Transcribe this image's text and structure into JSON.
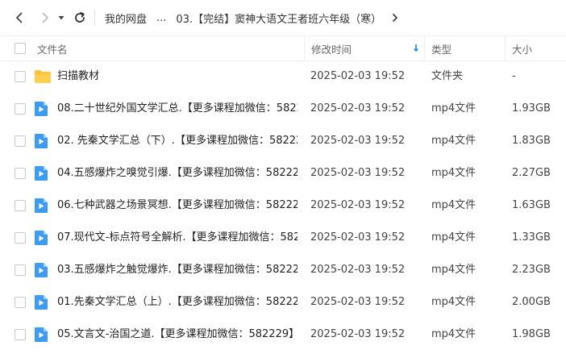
{
  "breadcrumb": {
    "root": "我的网盘",
    "ellipsis": "...",
    "current": "03.【完结】窦神大语文王者班六年级（寒）"
  },
  "columns": {
    "name": "文件名",
    "modified": "修改时间",
    "type": "类型",
    "size": "大小"
  },
  "files": [
    {
      "name": "扫描教材",
      "modified": "2025-02-03 19:52",
      "type": "文件夹",
      "size": "-",
      "icon": "folder-icon"
    },
    {
      "name": "08.二十世纪外国文学汇总.【更多课程加微信：58222...",
      "modified": "2025-02-03 19:52",
      "type": "mp4文件",
      "size": "1.93GB",
      "icon": "video-file-icon"
    },
    {
      "name": "02. 先秦文学汇总（下）.【更多课程加微信：582229...",
      "modified": "2025-02-03 19:52",
      "type": "mp4文件",
      "size": "1.83GB",
      "icon": "video-file-icon"
    },
    {
      "name": "04.五感爆炸之嗅觉引爆.【更多课程加微信：582229...",
      "modified": "2025-02-03 19:52",
      "type": "mp4文件",
      "size": "2.27GB",
      "icon": "video-file-icon"
    },
    {
      "name": "06.七种武器之场景冥想.【更多课程加微信：582229...",
      "modified": "2025-02-03 19:52",
      "type": "mp4文件",
      "size": "1.63GB",
      "icon": "video-file-icon"
    },
    {
      "name": "07.现代文-标点符号全解析.【更多课程加微信：5822...",
      "modified": "2025-02-03 19:52",
      "type": "mp4文件",
      "size": "1.33GB",
      "icon": "video-file-icon"
    },
    {
      "name": "03.五感爆炸之触觉爆炸.【更多课程加微信：582229...",
      "modified": "2025-02-03 19:52",
      "type": "mp4文件",
      "size": "2.23GB",
      "icon": "video-file-icon"
    },
    {
      "name": "01.先秦文学汇总（上）.【更多课程加微信：582229...",
      "modified": "2025-02-03 19:52",
      "type": "mp4文件",
      "size": "2.00GB",
      "icon": "video-file-icon"
    },
    {
      "name": "05.文言文-治国之道.【更多课程加微信：582229】.m...",
      "modified": "2025-02-03 19:52",
      "type": "mp4文件",
      "size": "1.98GB",
      "icon": "video-file-icon"
    }
  ],
  "colors": {
    "accent": "#1e88e5",
    "folder": "#ffc233",
    "video_icon": "#3d9cf0"
  }
}
